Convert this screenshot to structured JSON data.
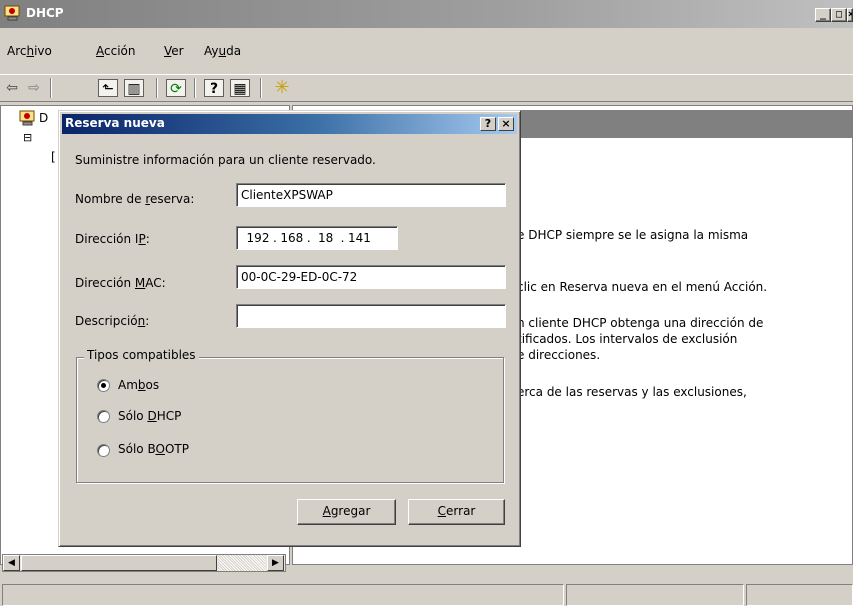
{
  "window": {
    "title": "DHCP",
    "controls": {
      "minimize": "_",
      "maximize": "□",
      "close": "×"
    }
  },
  "menu": {
    "items": [
      {
        "pre": "Arc",
        "key": "h",
        "post": "ivo"
      },
      {
        "pre": "",
        "key": "A",
        "post": "cción"
      },
      {
        "pre": "",
        "key": "V",
        "post": "er"
      },
      {
        "pre": "Ay",
        "key": "u",
        "post": "da"
      }
    ]
  },
  "toolbar": {
    "back": "⇦",
    "forward": "⇨",
    "up": "⬑",
    "show_hide": "▥",
    "refresh": "⟳",
    "properties": "?",
    "view": "▦",
    "new": "✳"
  },
  "tree": {
    "root_initial": "D",
    "expander": "⊟",
    "child_bracket": "["
  },
  "right_pane": {
    "lines": [
      "e DHCP siempre se le asigna la misma",
      "clic en Reserva nueva en el menú Acción.",
      "n cliente DHCP obtenga una dirección de",
      "tificados. Los intervalos de exclusión",
      "e direcciones.",
      "erca de las reservas y las exclusiones,"
    ]
  },
  "dialog": {
    "title": "Reserva nueva",
    "help": "?",
    "close": "×",
    "intro": "Suministre información para un cliente reservado.",
    "name_label": {
      "pre": "Nombre de ",
      "key": "r",
      "post": "eserva:"
    },
    "name_value": "ClienteXPSWAP",
    "ip_label": {
      "pre": "Dirección I",
      "key": "P",
      "post": ":"
    },
    "ip_octets": [
      "192",
      "168",
      "18",
      "141"
    ],
    "ip_sep": ".",
    "mac_label": {
      "pre": "Dirección ",
      "key": "M",
      "post": "AC:"
    },
    "mac_value": "00-0C-29-ED-0C-72",
    "desc_label": {
      "pre": "Descripció",
      "key": "n",
      "post": ":"
    },
    "desc_value": "",
    "types_group": "Tipos compatibles",
    "radios": [
      {
        "pre": "Am",
        "key": "b",
        "post": "os",
        "checked": true
      },
      {
        "pre": "Sólo ",
        "key": "D",
        "post": "HCP",
        "checked": false
      },
      {
        "pre": "Sólo B",
        "key": "O",
        "post": "OTP",
        "checked": false
      }
    ],
    "add_button": {
      "pre": "",
      "key": "A",
      "post": "gregar"
    },
    "close_button": {
      "pre": "",
      "key": "C",
      "post": "errar"
    }
  },
  "scrollbar": {
    "left": "◀",
    "right": "▶"
  }
}
